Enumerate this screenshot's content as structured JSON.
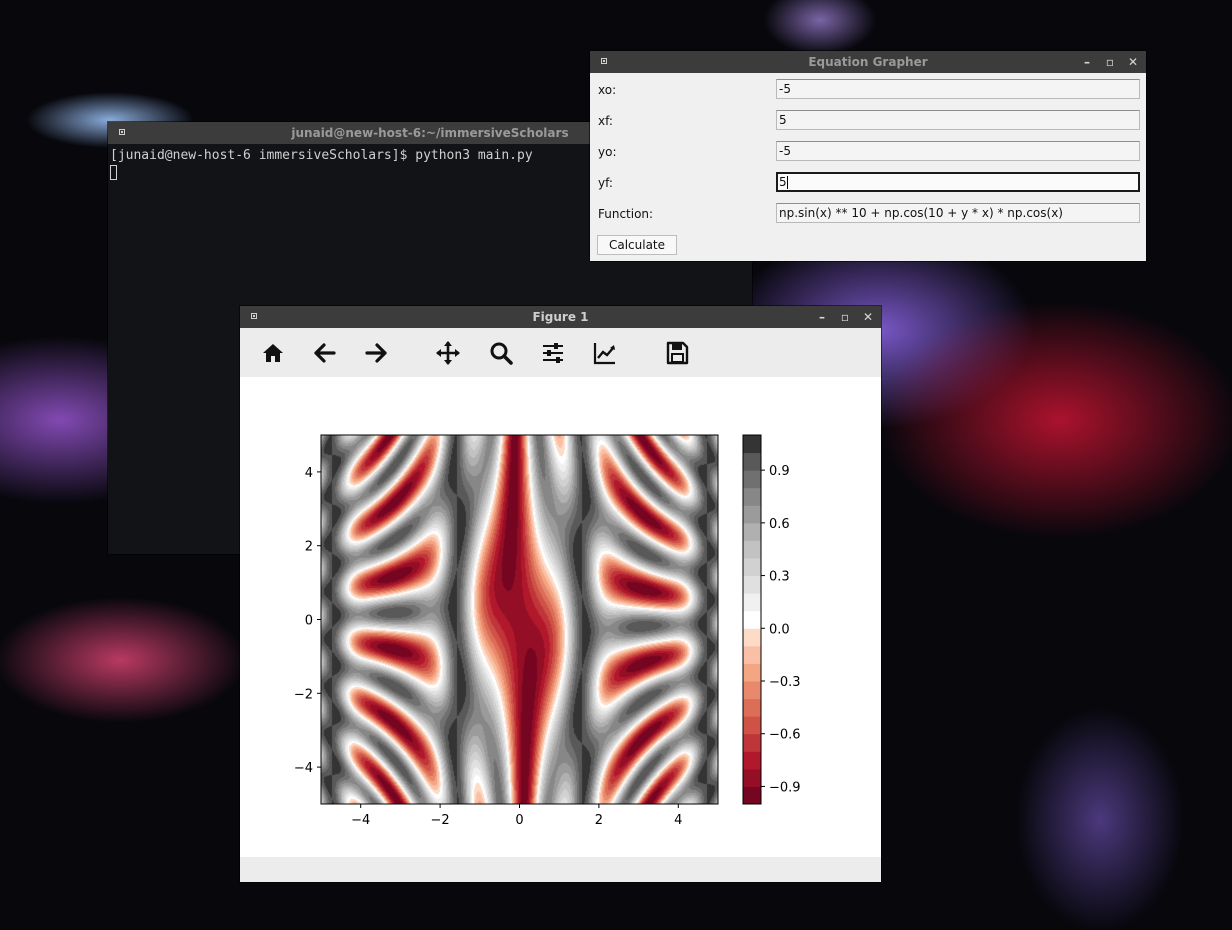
{
  "terminal": {
    "title": "junaid@new-host-6:~/immersiveScholars",
    "prompt_line": "[junaid@new-host-6 immersiveScholars]$ python3 main.py"
  },
  "grapher": {
    "title": "Equation Grapher",
    "fields": [
      {
        "label": "xo:",
        "value": "-5"
      },
      {
        "label": "xf:",
        "value": "5"
      },
      {
        "label": "yo:",
        "value": "-5"
      },
      {
        "label": "yf:",
        "value": "5"
      },
      {
        "label": "Function:",
        "value": "np.sin(x) ** 10 + np.cos(10 + y * x) * np.cos(x)"
      }
    ],
    "calculate_label": "Calculate"
  },
  "figure": {
    "title": "Figure 1",
    "toolbar_icons": [
      "home-icon",
      "back-arrow-icon",
      "forward-arrow-icon",
      "pan-icon",
      "zoom-icon",
      "configure-subplots-icon",
      "edit-axis-icon",
      "save-icon"
    ]
  },
  "chart_data": {
    "type": "heatmap",
    "title": "",
    "xlabel": "",
    "ylabel": "",
    "function": "np.sin(x) ** 10 + np.cos(10 + y * x) * np.cos(x)",
    "x_range": [
      -5,
      5
    ],
    "y_range": [
      -5,
      5
    ],
    "xticks": [
      "−4",
      "−2",
      "0",
      "2",
      "4"
    ],
    "yticks": [
      "4",
      "2",
      "0",
      "−2",
      "−4"
    ],
    "colormap": "RdGy",
    "levels": [
      -1.0,
      -0.9,
      -0.8,
      -0.7,
      -0.6,
      -0.5,
      -0.4,
      -0.3,
      -0.2,
      -0.1,
      0.0,
      0.1,
      0.2,
      0.3,
      0.4,
      0.5,
      0.6,
      0.7,
      0.8,
      0.9,
      1.0,
      1.1
    ],
    "colorbar_ticks": [
      "0.9",
      "0.6",
      "0.3",
      "0.0",
      "−0.3",
      "−0.6",
      "−0.9"
    ],
    "colorbar_tick_values": [
      0.9,
      0.6,
      0.3,
      0.0,
      -0.3,
      -0.6,
      -0.9
    ],
    "colorbar_range": [
      -1.0,
      1.1
    ],
    "colors": {
      "low": "#67001f",
      "mid": "#ffffff",
      "high": "#1a1a1a"
    }
  }
}
